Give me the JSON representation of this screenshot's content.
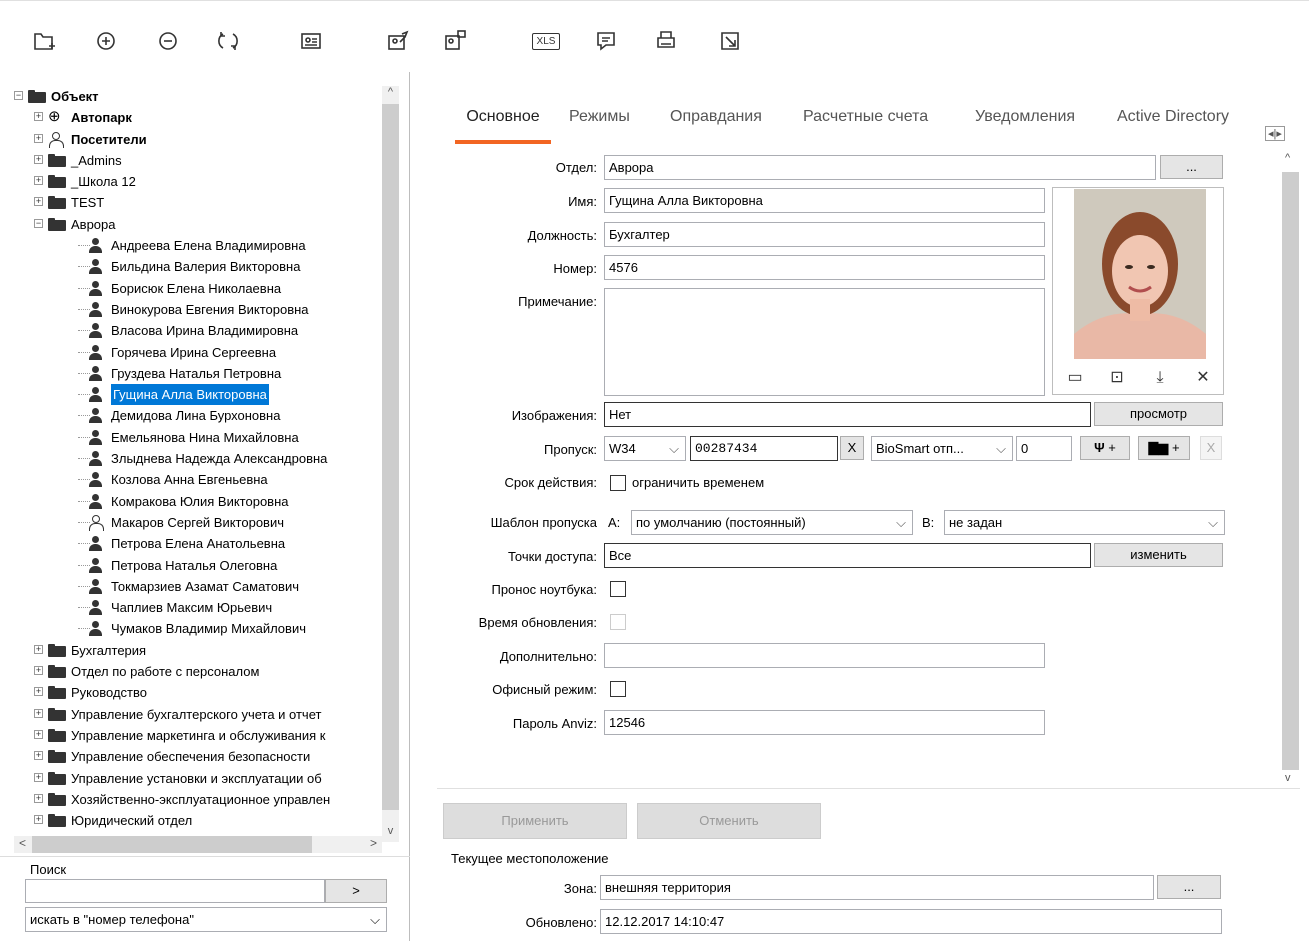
{
  "toolbar": {
    "icons": [
      "add-folder-icon",
      "add-circle-icon",
      "remove-circle-icon",
      "refresh-icon",
      "id-card-icon",
      "edit-card-icon",
      "card-network-icon",
      "xls-export-icon",
      "comment-icon",
      "print-icon",
      "export-icon"
    ],
    "xls_label": "XLS"
  },
  "tree": {
    "root": "Объект",
    "top": [
      {
        "label": "Автопарк",
        "icon": "vehicle-icon"
      },
      {
        "label": "Посетители",
        "icon": "person-outline-icon"
      },
      {
        "label": "_Admins",
        "icon": "folder-icon"
      },
      {
        "label": "_Школа 12",
        "icon": "folder-icon"
      },
      {
        "label": "TEST",
        "icon": "folder-icon"
      },
      {
        "label": "Аврора",
        "icon": "folder-icon"
      }
    ],
    "people": [
      "Андреева Елена Владимировна",
      "Бильдина Валерия Викторовна",
      "Борисюк Елена Николаевна",
      "Винокурова Евгения Викторовна",
      "Власова Ирина Владимировна",
      "Горячева Ирина Сергеевна",
      "Груздева Наталья Петровна",
      "Гущина Алла Викторовна",
      "Демидова Лина Бурхоновна",
      "Емельянова  Нина Михайловна",
      "Злыднева Надежда Александровна",
      "Козлова Анна Евгеньевна",
      "Комракова Юлия Викторовна",
      "Макаров Сергей Викторович",
      "Петрова Елена Анатольевна",
      "Петрова Наталья Олеговна",
      "Токмарзиев Азамат Саматович",
      "Чаплиев Максим Юрьевич",
      "Чумаков Владимир Михайлович"
    ],
    "selected": "Гущина Алла Викторовна",
    "bottom": [
      "Бухгалтерия",
      "Отдел по работе с персоналом",
      "Руководство",
      "Управление бухгалтерского учета и отчет",
      "Управление маркетинга и обслуживания к",
      "Управление обеспечения безопасности",
      "Управление установки и эксплуатации об",
      "Хозяйственно-эксплуатационное управлен",
      "Юридический отдел"
    ]
  },
  "search": {
    "label": "Поиск",
    "go": ">",
    "scope": "искать в \"номер телефона\""
  },
  "tabs": [
    "Основное",
    "Режимы",
    "Оправдания",
    "Расчетные счета",
    "Уведомления",
    "Active Directory"
  ],
  "form": {
    "dept_label": "Отдел:",
    "dept": "Аврора",
    "browse": "...",
    "name_label": "Имя:",
    "name": "Гущина Алла Викторовна",
    "pos_label": "Должность:",
    "pos": "Бухгалтер",
    "num_label": "Номер:",
    "num": "4576",
    "note_label": "Примечание:",
    "img_label": "Изображения:",
    "img": "Нет",
    "view": "просмотр",
    "pass_label": "Пропуск:",
    "pass_fmt": "W34",
    "pass_code": "00287434",
    "pass_x": "X",
    "pass_dev": "BioSmart отп...",
    "pass_zero": "0",
    "usb_plus": "+",
    "net_plus": "+",
    "x_dis": "X",
    "term_label": "Срок действия:",
    "term_cb": "ограничить временем",
    "tpl_label": "Шаблон пропуска",
    "a_label": "A:",
    "a_val": "по умолчанию (постоянный)",
    "b_label": "B:",
    "b_val": "не задан",
    "ap_label": "Точки доступа:",
    "ap": "Все",
    "change": "изменить",
    "laptop_label": "Пронос ноутбука:",
    "upd_label": "Время обновления:",
    "extra_label": "Дополнительно:",
    "office_label": "Офисный режим:",
    "anviz_label": "Пароль Anviz:",
    "anviz": "12546"
  },
  "actions": {
    "apply": "Применить",
    "cancel": "Отменить"
  },
  "location": {
    "title": "Текущее местоположение",
    "zone_label": "Зона:",
    "zone": "внешняя территория",
    "upd_label": "Обновлено:",
    "upd": "12.12.2017 14:10:47",
    "browse": "..."
  }
}
